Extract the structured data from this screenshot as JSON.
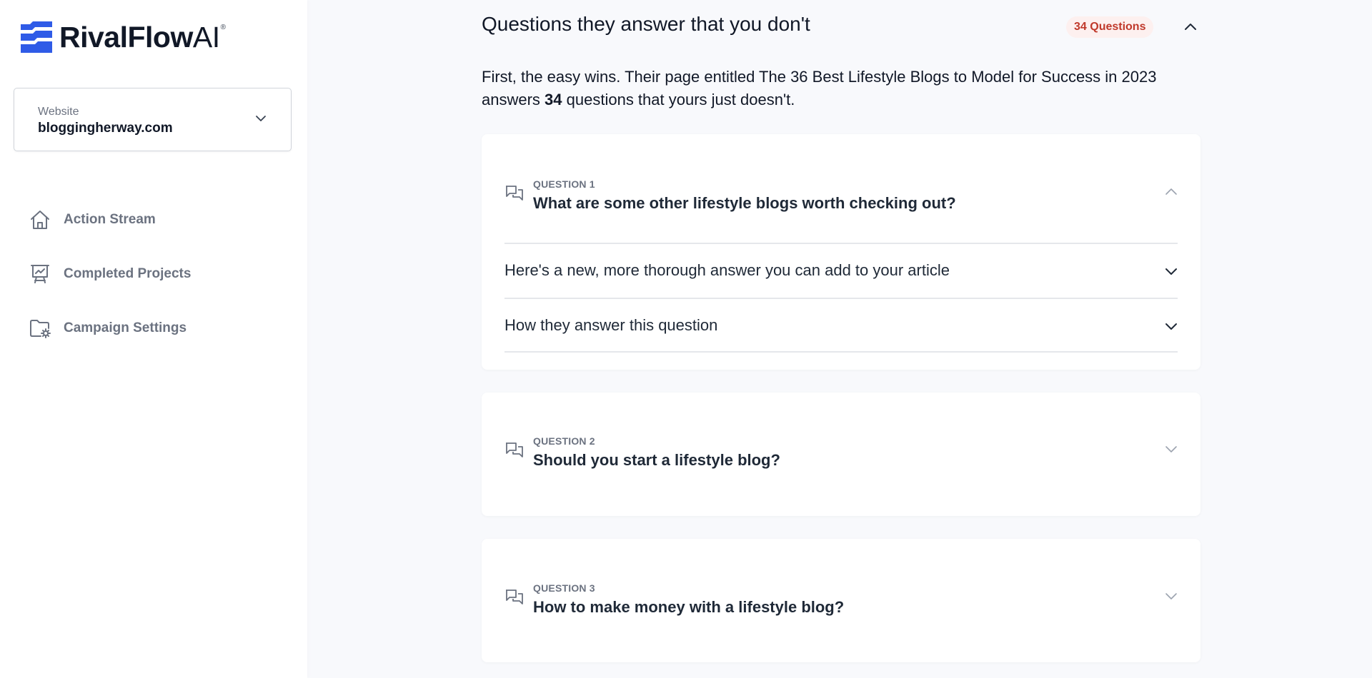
{
  "brand": {
    "name_bold": "RivalFlow",
    "name_light": "AI",
    "registered": "®",
    "color": "#2f5be7"
  },
  "website_selector": {
    "label": "Website",
    "value": "bloggingherway.com",
    "icon": "chevron-down-icon"
  },
  "sidebar": {
    "items": [
      {
        "label": "Action Stream",
        "icon": "home-icon"
      },
      {
        "label": "Completed Projects",
        "icon": "presentation-chart-icon"
      },
      {
        "label": "Campaign Settings",
        "icon": "folder-settings-icon"
      }
    ]
  },
  "section": {
    "title": "Questions they answer that you don't",
    "badge": "34 Questions",
    "badge_color": "#c0392b",
    "collapse_icon": "chevron-up-icon",
    "intro_before": "First, the easy wins. Their page entitled The 36 Best Lifestyle Blogs to Model for Success in 2023 answers ",
    "intro_count": "34",
    "intro_after": " questions that yours just doesn't."
  },
  "questions": [
    {
      "number_label": "QUESTION 1",
      "text": "What are some other lifestyle blogs worth checking out?",
      "expanded": true,
      "subsections": [
        {
          "label": "Here's a new, more thorough answer you can add to your article"
        },
        {
          "label": "How they answer this question"
        }
      ]
    },
    {
      "number_label": "QUESTION 2",
      "text": "Should you start a lifestyle blog?",
      "expanded": false
    },
    {
      "number_label": "QUESTION 3",
      "text": "How to make money with a lifestyle blog?",
      "expanded": false
    }
  ]
}
